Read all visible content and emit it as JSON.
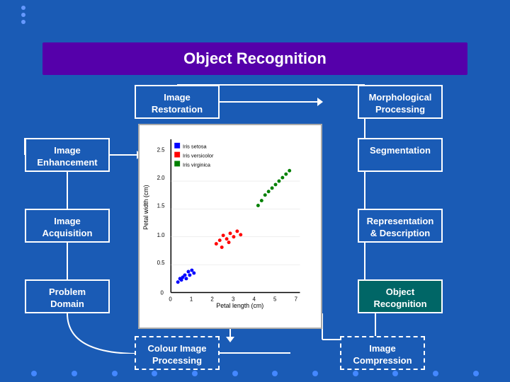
{
  "title": "Object Recognition",
  "boxes": {
    "image_restoration": "Image Restoration",
    "morphological": "Morphological Processing",
    "image_enhancement": "Image Enhancement",
    "segmentation": "Segmentation",
    "image_acquisition": "Image Acquisition",
    "representation": "Representation & Description",
    "problem_domain": "Problem Domain",
    "object_recognition_bottom": "Object Recognition",
    "colour_image": "Colour Image Processing",
    "image_compression": "Image Compression"
  },
  "dots": {
    "top_count": 3,
    "bottom_count": 12
  },
  "colors": {
    "background": "#1a5bb5",
    "title_bg": "#5500aa",
    "teal_box": "#006666",
    "white": "#ffffff"
  }
}
